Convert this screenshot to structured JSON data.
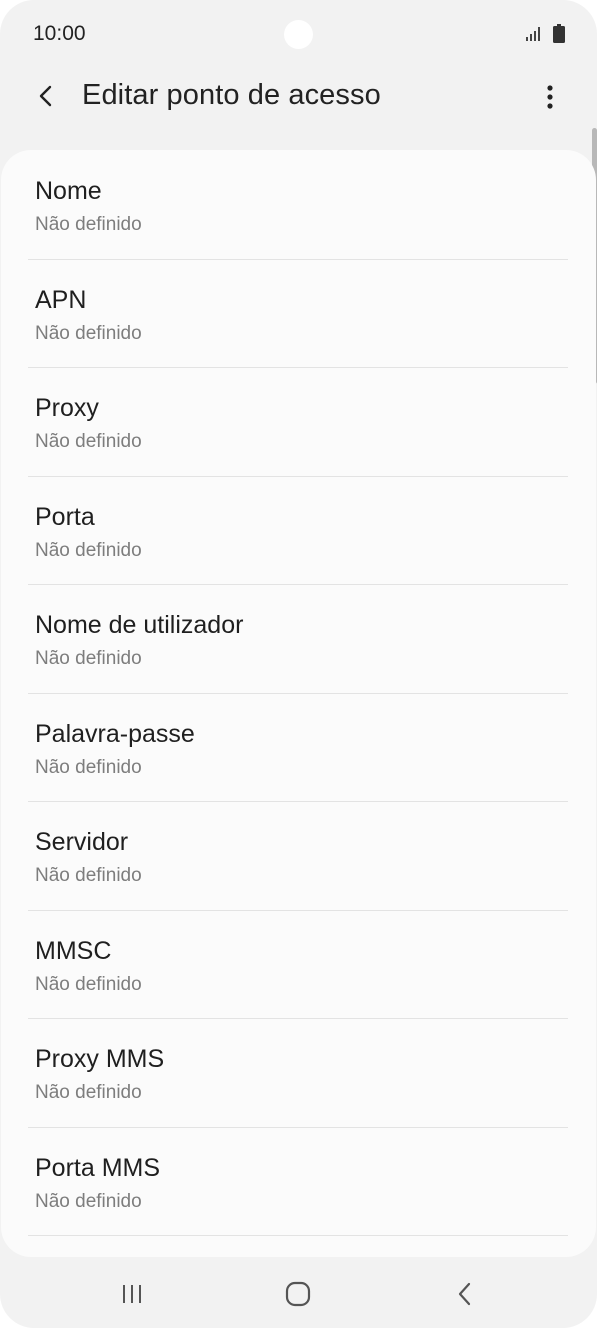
{
  "status_bar": {
    "time": "10:00",
    "icons": [
      "signal-icon",
      "battery-icon"
    ]
  },
  "app_bar": {
    "title": "Editar ponto de acesso",
    "back_icon": "chevron-left-icon",
    "menu_icon": "more-vertical-icon"
  },
  "settings": {
    "items": [
      {
        "label": "Nome",
        "value": "Não definido"
      },
      {
        "label": "APN",
        "value": "Não definido"
      },
      {
        "label": "Proxy",
        "value": "Não definido"
      },
      {
        "label": "Porta",
        "value": "Não definido"
      },
      {
        "label": "Nome de utilizador",
        "value": "Não definido"
      },
      {
        "label": "Palavra-passe",
        "value": "Não definido"
      },
      {
        "label": "Servidor",
        "value": "Não definido"
      },
      {
        "label": "MMSC",
        "value": "Não definido"
      },
      {
        "label": "Proxy MMS",
        "value": "Não definido"
      },
      {
        "label": "Porta MMS",
        "value": "Não definido"
      }
    ]
  },
  "nav_bar": {
    "icons": [
      "recent-apps-icon",
      "home-icon",
      "back-icon"
    ]
  },
  "colors": {
    "background": "#f2f2f2",
    "card": "#fbfbfb",
    "primary_text": "#1f1f1f",
    "secondary_text": "#7d7d7d",
    "divider": "#e3e3e3"
  }
}
